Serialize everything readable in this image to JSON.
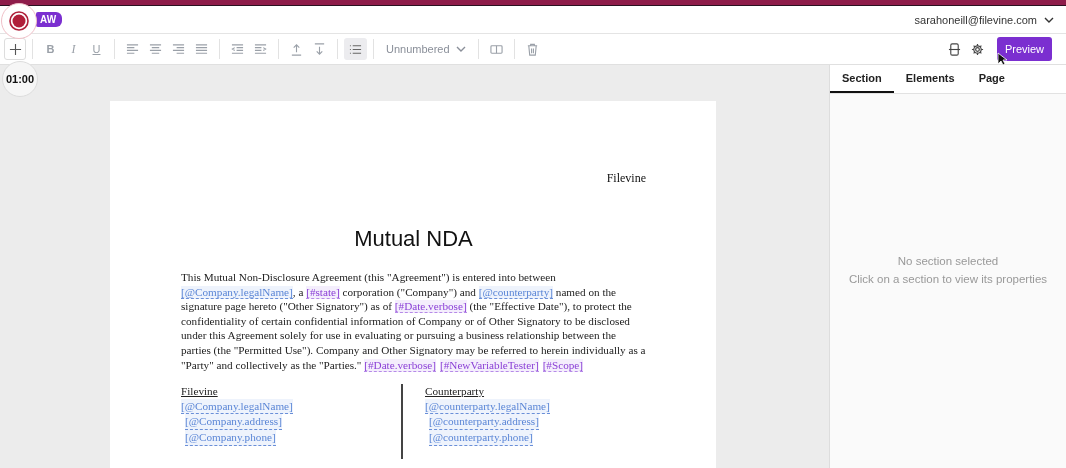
{
  "header": {
    "logo": "AW",
    "account": "sarahoneill@filevine.com"
  },
  "recorder": {
    "timer": "01:00"
  },
  "toolbar": {
    "groups": [
      [
        {
          "kind": "add",
          "selected": false
        }
      ],
      [
        {
          "kind": "bold",
          "label": "B",
          "selected": false
        },
        {
          "kind": "italic",
          "label": "I",
          "selected": false
        },
        {
          "kind": "underline",
          "label": "U",
          "selected": false
        }
      ],
      [
        {
          "kind": "align-left",
          "selected": false
        },
        {
          "kind": "align-center",
          "selected": false
        },
        {
          "kind": "align-right",
          "selected": false
        },
        {
          "kind": "align-justify",
          "selected": false
        }
      ],
      [
        {
          "kind": "outdent",
          "selected": false
        },
        {
          "kind": "indent",
          "selected": false
        }
      ],
      [
        {
          "kind": "move-up",
          "selected": false
        },
        {
          "kind": "move-down",
          "selected": false
        }
      ],
      [
        {
          "kind": "list",
          "selected": true
        }
      ],
      [
        {
          "kind": "dropdown",
          "label": "Unnumbered",
          "selected": false
        }
      ],
      [
        {
          "kind": "columns",
          "selected": false
        }
      ],
      [
        {
          "kind": "delete",
          "selected": false
        }
      ]
    ],
    "right": [
      {
        "kind": "page-break"
      },
      {
        "kind": "settings"
      }
    ],
    "preview": "Preview"
  },
  "document": {
    "header": "Filevine",
    "title": "Mutual NDA",
    "paragraph": [
      {
        "kind": "text",
        "text": "This Mutual Non-Disclosure Agreement (this \"Agreement\") is entered into between "
      },
      {
        "kind": "field",
        "text": "[@Company.legalName]"
      },
      {
        "kind": "text",
        "text": ", a "
      },
      {
        "kind": "variable",
        "text": "[#state]"
      },
      {
        "kind": "text",
        "text": " corporation (\"Company\") and "
      },
      {
        "kind": "field",
        "text": "[@counterparty]"
      },
      {
        "kind": "text",
        "text": "  named on the signature page hereto (\"Other Signatory\") as of "
      },
      {
        "kind": "variable",
        "text": "[#Date.verbose]"
      },
      {
        "kind": "text",
        "text": " (the \"Effective Date\"), to protect the confidentiality of certain confidential information of Company or of Other Signatory to be disclosed under this Agreement solely for use in evaluating or pursuing a business relationship between the parties (the \"Permitted Use\"). Company and Other Signatory may be referred to herein individually as a \"Party\" and collectively as the \"Parties.\"  "
      },
      {
        "kind": "variable",
        "text": "[#Date.verbose]"
      },
      {
        "kind": "variable",
        "text": "[#NewVariableTester]"
      },
      {
        "kind": "variable",
        "text": "[#Scope]"
      }
    ],
    "signatures": [
      {
        "heading": "Filevine",
        "fields": [
          "[@Company.legalName]",
          "[@Company.address]",
          "[@Company.phone]"
        ]
      },
      {
        "heading": "Counterparty",
        "fields": [
          "[@counterparty.legalName]",
          "[@counterparty.address]",
          "[@counterparty.phone]"
        ]
      }
    ]
  },
  "panel": {
    "tabs": [
      {
        "label": "Section",
        "selected": true
      },
      {
        "label": "Elements",
        "selected": false
      },
      {
        "label": "Page",
        "selected": false
      }
    ],
    "empty_title": "No section selected",
    "empty_hint": "Click on a section to view its properties"
  }
}
